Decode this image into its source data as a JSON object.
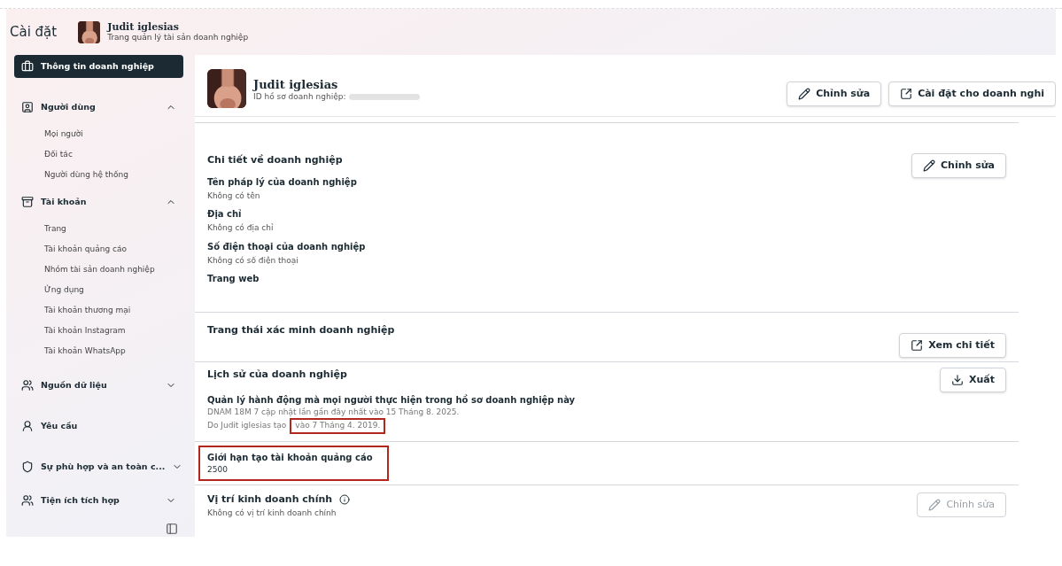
{
  "header": {
    "title": "Cài đặt",
    "account_name": "Judit iglesias",
    "account_subtitle": "Trang quản lý tài sản doanh nghiệp"
  },
  "sidebar": {
    "items": [
      {
        "label": "Thông tin doanh nghiệp",
        "selected": true
      },
      {
        "label": "Người dùng",
        "selected": false,
        "expanded": true,
        "children": [
          {
            "label": "Mọi người"
          },
          {
            "label": "Đối tác"
          },
          {
            "label": "Người dùng hệ thống"
          }
        ]
      },
      {
        "label": "Tài khoản",
        "selected": false,
        "expanded": true,
        "children": [
          {
            "label": "Trang"
          },
          {
            "label": "Tài khoản quảng cáo"
          },
          {
            "label": "Nhóm tài sản doanh nghiệp"
          },
          {
            "label": "Ứng dụng"
          },
          {
            "label": "Tài khoản thương mại"
          },
          {
            "label": "Tài khoản Instagram"
          },
          {
            "label": "Tài khoản WhatsApp"
          }
        ]
      },
      {
        "label": "Nguồn dữ liệu",
        "selected": false,
        "expanded": false
      },
      {
        "label": "Yêu cầu",
        "selected": false
      },
      {
        "label": "Sự phù hợp và an toàn c...",
        "selected": false,
        "expanded": false
      },
      {
        "label": "Tiện ích tích hợp",
        "selected": false,
        "expanded": false
      }
    ]
  },
  "profile": {
    "name": "Judit iglesias",
    "id_label": "ID hồ sơ doanh nghiệp:",
    "buttons": [
      {
        "label": "Chỉnh sửa"
      },
      {
        "label": "Cài đặt cho doanh nghi"
      }
    ]
  },
  "sections": [
    {
      "kind": "details",
      "title": "Chi tiết về doanh nghiệp",
      "button": {
        "label": "Chỉnh sửa",
        "disabled": false
      },
      "fields": [
        {
          "label": "Tên pháp lý của doanh nghiệp",
          "value": "Không có tên"
        },
        {
          "label": "Địa chỉ",
          "value": "Không có địa chỉ"
        },
        {
          "label": "Số điện thoại của doanh nghiệp",
          "value": "Không có số điện thoại"
        },
        {
          "label": "Trang web"
        }
      ]
    },
    {
      "kind": "verification",
      "title": "Trang thái xác minh doanh nghiệp",
      "button": {
        "label": "Xem chi tiết",
        "disabled": false
      }
    },
    {
      "kind": "history",
      "title": "Lịch sử của doanh nghiệp",
      "button": {
        "label": "Xuất",
        "disabled": false
      },
      "heading": "Quản lý hành động mà mọi người thực hiện trong hồ sơ doanh nghiệp này",
      "updated": "DNAM 18M 7 cập nhật lần gần đây nhất vào 15 Tháng 8. 2025.",
      "created_by": "Do Judit iglesias tạo",
      "created_date": {
        "text": "vào 7 Tháng 4. 2019.",
        "highlighted": true
      }
    },
    {
      "kind": "limit",
      "title": "Giới hạn tạo tài khoản quảng cáo",
      "value": "2500",
      "highlighted": true
    },
    {
      "kind": "location",
      "title": "Vị trí kinh doanh chính",
      "value": "Không có vị trí kinh doanh chính",
      "info": true,
      "button": {
        "label": "Chỉnh sửa",
        "disabled": true
      }
    }
  ]
}
